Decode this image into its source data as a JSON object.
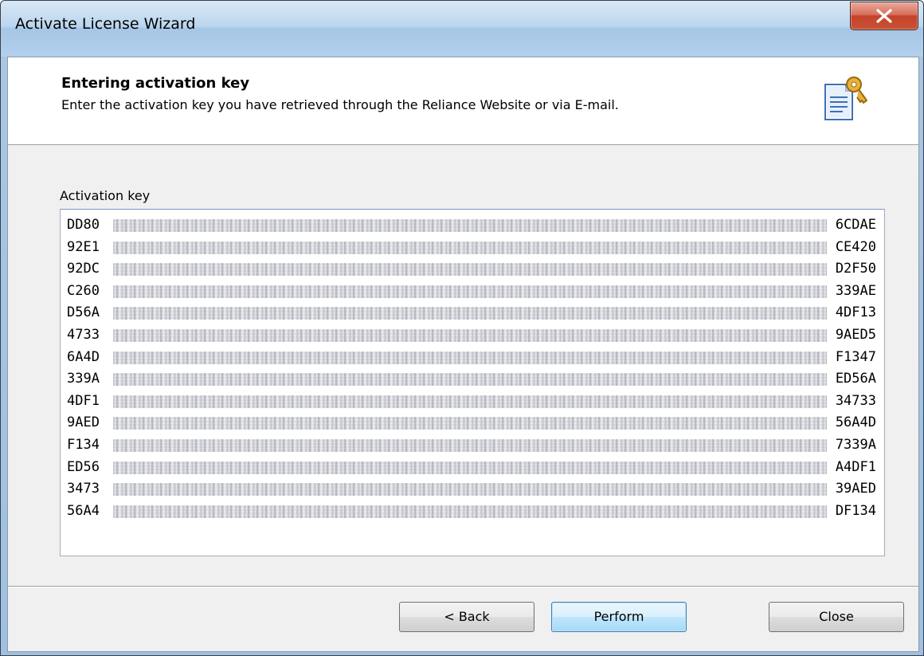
{
  "window": {
    "title": "Activate License Wizard",
    "close_glyph": "X"
  },
  "header": {
    "title": "Entering activation key",
    "subtitle": "Enter the activation key you have retrieved through the Reliance Website or via E-mail.",
    "icon": "license-key-document-icon"
  },
  "activation": {
    "label": "Activation key",
    "lines": [
      {
        "start": "DD80",
        "end": "6CDAE"
      },
      {
        "start": "92E1",
        "end": "CE420"
      },
      {
        "start": "92DC",
        "end": "D2F50"
      },
      {
        "start": "C260",
        "end": "339AE"
      },
      {
        "start": "D56A",
        "end": "4DF13"
      },
      {
        "start": "4733",
        "end": "9AED5"
      },
      {
        "start": "6A4D",
        "end": "F1347"
      },
      {
        "start": "339A",
        "end": "ED56A"
      },
      {
        "start": "4DF1",
        "end": "34733"
      },
      {
        "start": "9AED",
        "end": "56A4D"
      },
      {
        "start": "F134",
        "end": "7339A"
      },
      {
        "start": "ED56",
        "end": "A4DF1"
      },
      {
        "start": "3473",
        "end": "39AED"
      },
      {
        "start": "56A4",
        "end": "DF134"
      }
    ]
  },
  "buttons": {
    "back": "< Back",
    "perform": "Perform",
    "close": "Close"
  },
  "colors": {
    "titlebar": "#bcd6ee",
    "close_button": "#c4432b",
    "client_bg": "#f0f0f0",
    "default_button": "#bee6fd"
  }
}
